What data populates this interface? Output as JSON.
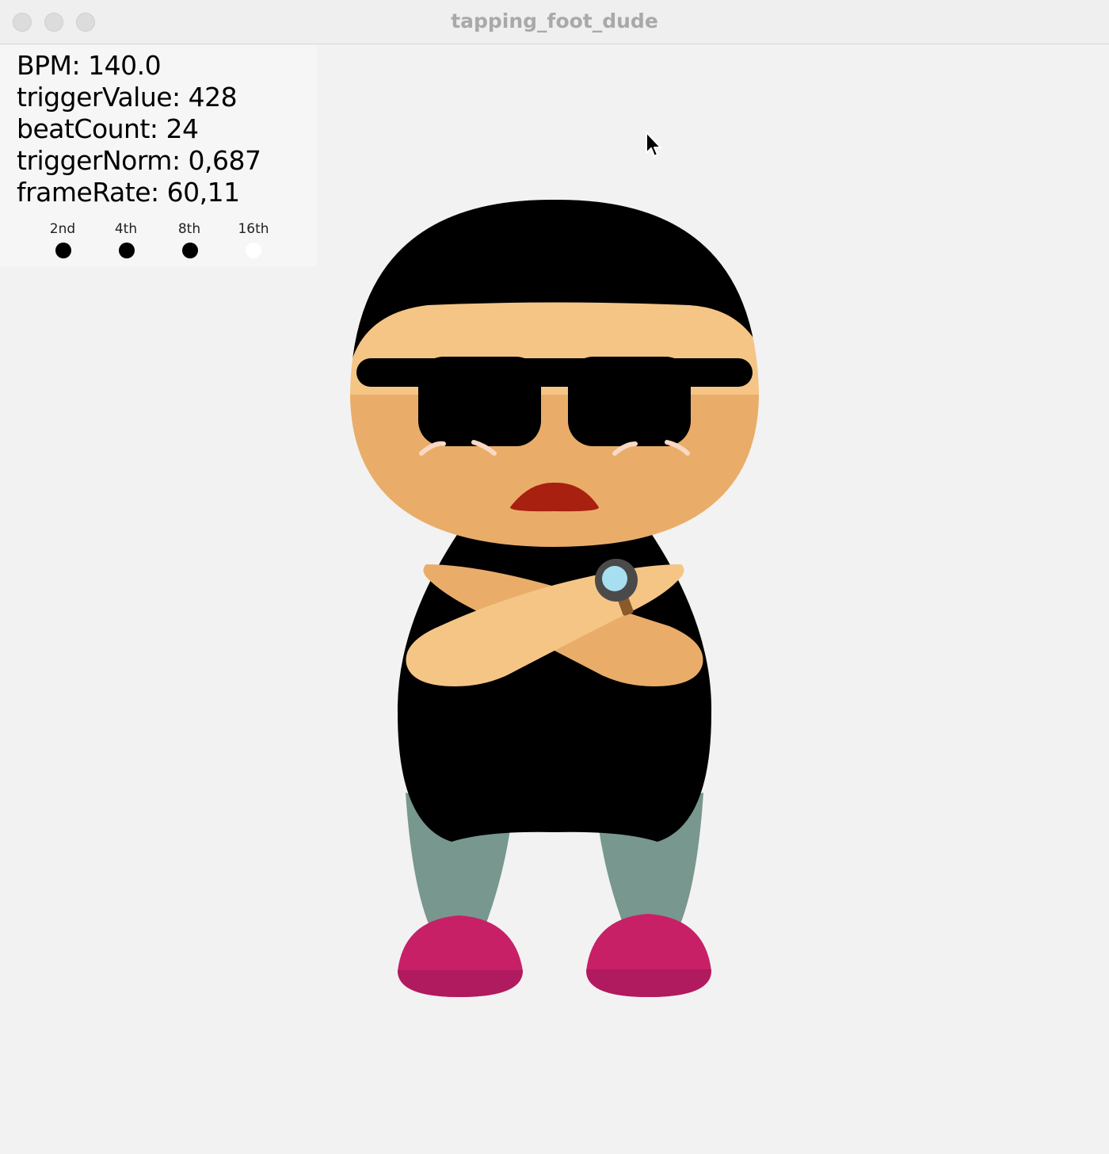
{
  "window": {
    "title": "tapping_foot_dude"
  },
  "stats": {
    "bpm": "BPM: 140.0",
    "trigger_value": "triggerValue: 428",
    "beat_count": "beatCount: 24",
    "trigger_norm": "triggerNorm: 0,687",
    "frame_rate": "frameRate: 60,11"
  },
  "beat_indicators": [
    {
      "label": "2nd",
      "active": true
    },
    {
      "label": "4th",
      "active": true
    },
    {
      "label": "8th",
      "active": true
    },
    {
      "label": "16th",
      "active": false
    }
  ],
  "colors": {
    "active_dot": "#000000",
    "inactive_dot": "#ffffff",
    "skin_light": "#f5c586",
    "skin_dark": "#e9ad69",
    "mouth": "#a8200f",
    "pants": "#78978e",
    "shoes": "#c82066",
    "shoe_soles": "#b01a5e",
    "watch_face": "#a8dff0"
  },
  "icons": {
    "cursor": "arrow-cursor-icon"
  }
}
